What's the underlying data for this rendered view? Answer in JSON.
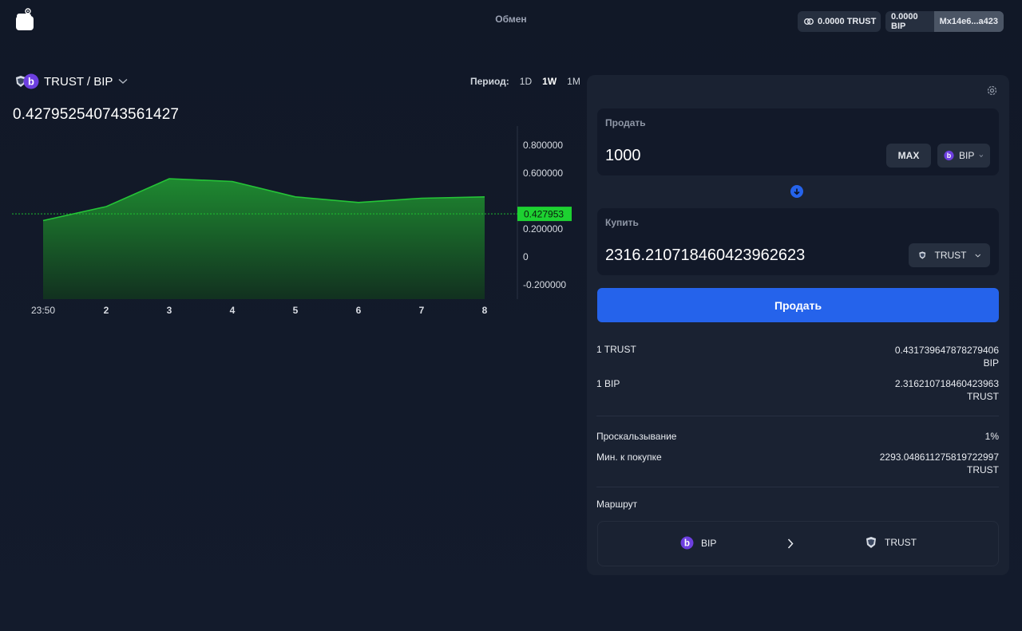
{
  "header": {
    "nav_exchange": "Обмен",
    "trust_balance": "0.0000 TRUST",
    "bip_balance": "0.0000 BIP",
    "address": "Mx14e6...a423"
  },
  "pair": {
    "label": "TRUST / BIP",
    "price": "0.427952540743561427"
  },
  "period": {
    "label": "Период:",
    "options": [
      "1D",
      "1W",
      "1M"
    ],
    "selected": "1W"
  },
  "chart_data": {
    "type": "area",
    "x": [
      "23:50",
      "2",
      "3",
      "4",
      "5",
      "6",
      "7",
      "8"
    ],
    "y": [
      0.26,
      0.36,
      0.56,
      0.54,
      0.43,
      0.39,
      0.42,
      0.43
    ],
    "ylim": [
      -0.3,
      0.95
    ],
    "yticks": [
      "0.800000",
      "0.600000",
      "0.200000",
      "0",
      "-0.200000"
    ],
    "current_label": "0.427953",
    "current_value": 0.427953,
    "colors": {
      "line": "#25c437",
      "fill_top": "#1f8f31",
      "fill_bottom": "#12321f",
      "tag": "#1dd131"
    }
  },
  "swap": {
    "sell_label": "Продать",
    "sell_amount": "1000",
    "max_label": "MAX",
    "sell_token": "BIP",
    "buy_label": "Купить",
    "buy_amount": "2316.210718460423962623",
    "buy_token": "TRUST",
    "submit_label": "Продать"
  },
  "rates": {
    "trust_label": "1 TRUST",
    "trust_value": "0.431739647878279406",
    "trust_unit": "BIP",
    "bip_label": "1 BIP",
    "bip_value": "2.316210718460423963",
    "bip_unit": "TRUST"
  },
  "details": {
    "slippage_label": "Проскальзывание",
    "slippage_value": "1%",
    "min_label": "Мин. к покупке",
    "min_value": "2293.048611275819722997",
    "min_unit": "TRUST"
  },
  "route": {
    "label": "Маршрут",
    "from": "BIP",
    "to": "TRUST"
  },
  "colors": {
    "accent": "#2563eb",
    "background": "#121a2b",
    "card": "#1a2232",
    "bip": "#6d3fe0"
  }
}
